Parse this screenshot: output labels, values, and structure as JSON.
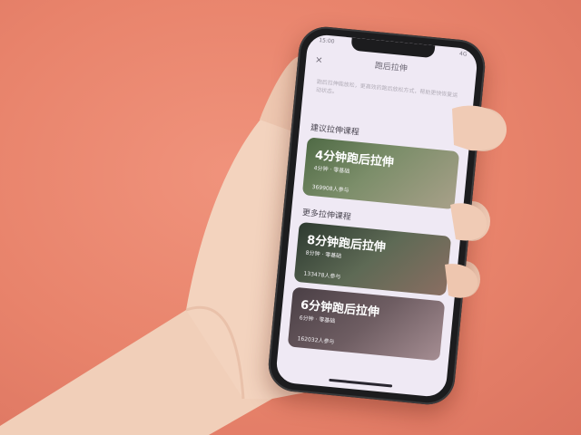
{
  "status_bar": {
    "time": "15:00",
    "signal": "4G"
  },
  "nav": {
    "back_icon": "close-icon",
    "title": "跑后拉伸"
  },
  "description": "跑后拉伸能放松，更高效的跑后放松方式，帮助更快恢复运动状态。",
  "recommended": {
    "heading": "建议拉伸课程",
    "card": {
      "title": "4分钟跑后拉伸",
      "meta": "4分钟 · 零基础",
      "participants": "369908人参与"
    }
  },
  "more": {
    "heading": "更多拉伸课程",
    "cards": [
      {
        "title": "8分钟跑后拉伸",
        "meta": "8分钟 · 零基础",
        "participants": "133478人参与"
      },
      {
        "title": "6分钟跑后拉伸",
        "meta": "6分钟 · 零基础",
        "participants": "162032人参与"
      }
    ]
  }
}
